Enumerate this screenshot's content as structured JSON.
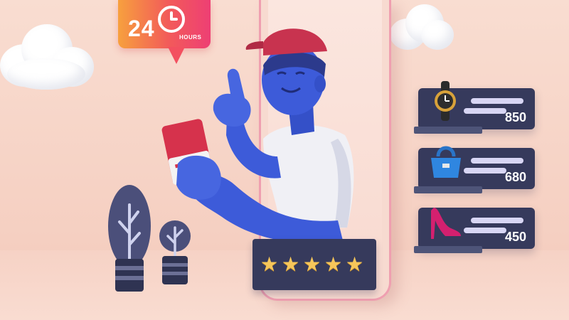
{
  "badge": {
    "number": "24",
    "label": "HOURS"
  },
  "rating": {
    "stars": 5
  },
  "products": [
    {
      "name": "watch",
      "icon": "wristwatch-icon",
      "value": "850"
    },
    {
      "name": "handbag",
      "icon": "handbag-icon",
      "value": "680"
    },
    {
      "name": "high-heel",
      "icon": "high-heel-shoe-icon",
      "value": "450"
    }
  ],
  "colors": {
    "background": "#f7d3c6",
    "character": "#3d5bd9",
    "cap": "#c8334f",
    "shirt": "#f2f2f6",
    "panel": "#363a5c",
    "star": "#f6c65a",
    "badge_start": "#f7a03e",
    "badge_end": "#ee3f74"
  }
}
